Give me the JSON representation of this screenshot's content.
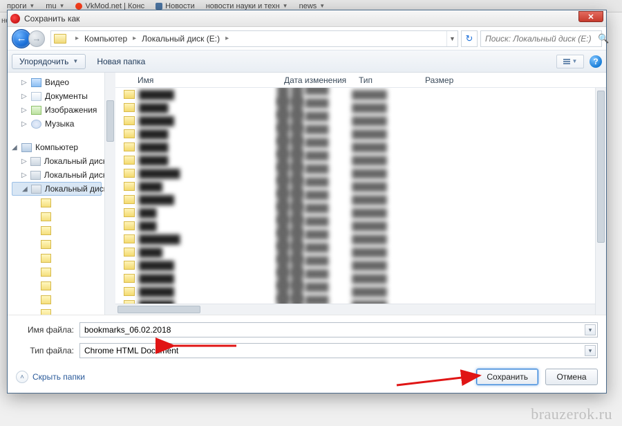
{
  "tabs": [
    "проги",
    "mu",
    "VkMod.net | Конс",
    "Новости",
    "новости науки и техн",
    "news"
  ],
  "sidecut": "нел",
  "dialog": {
    "title": "Сохранить как",
    "breadcrumb": {
      "root": "Компьютер",
      "path": "Локальный диск (E:)"
    },
    "search_placeholder": "Поиск: Локальный диск (E:)",
    "organize": "Упорядочить",
    "new_folder": "Новая папка",
    "columns": {
      "name": "Имя",
      "date": "Дата изменения",
      "type": "Тип",
      "size": "Размер"
    },
    "tree": {
      "libs": [
        {
          "label": "Видео",
          "icon": "ico-lib-video"
        },
        {
          "label": "Документы",
          "icon": "ico-lib-doc"
        },
        {
          "label": "Изображения",
          "icon": "ico-lib-img"
        },
        {
          "label": "Музыка",
          "icon": "ico-lib-music"
        }
      ],
      "computer": {
        "label": "Компьютер",
        "drives": [
          {
            "label": "Локальный диск (C:)",
            "selected": false,
            "expanded": false
          },
          {
            "label": "Локальный диск (D:)",
            "selected": false,
            "expanded": false
          },
          {
            "label": "Локальный диск (E:)",
            "selected": true,
            "expanded": true
          }
        ]
      }
    },
    "rows": 18,
    "filename_label": "Имя файла:",
    "filetype_label": "Тип файла:",
    "filename_value": "bookmarks_06.02.2018",
    "filetype_value": "Chrome HTML Document",
    "hide_folders": "Скрыть папки",
    "save": "Сохранить",
    "cancel": "Отмена"
  },
  "watermark": "brauzerok.ru"
}
